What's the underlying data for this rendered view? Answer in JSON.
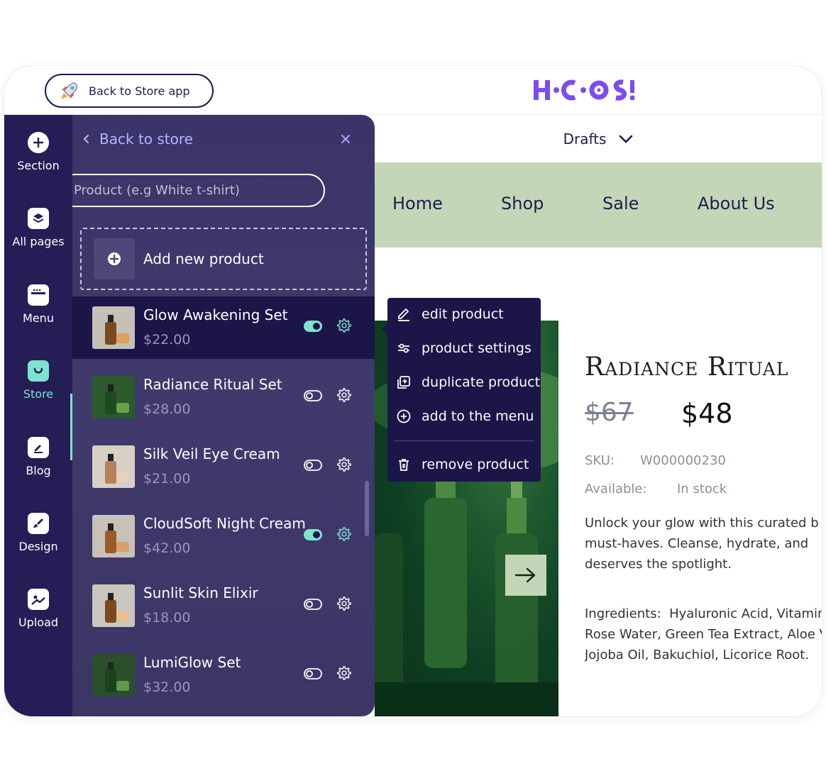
{
  "topbar": {
    "back_label": "Back to Store app",
    "logo_text": "HOCOOS"
  },
  "preview": {
    "drafts_label": "Drafts",
    "nav": [
      "Home",
      "Shop",
      "Sale",
      "About Us"
    ],
    "product": {
      "title": "Radiance Ritual",
      "old_price": "$67",
      "new_price": "$48",
      "sku_label": "SKU:",
      "sku_value": "W000000230",
      "available_label": "Available:",
      "available_value": "In stock",
      "description": "Unlock your glow with this curated b\nmust-haves. Cleanse, hydrate, and \ndeserves the spotlight.",
      "ingredients": "Ingredients:  Hyaluronic Acid, Vitamin\nRose Water, Green Tea Extract, Aloe V\nJojoba Oil, Bakuchiol, Licorice Root."
    }
  },
  "rail": [
    {
      "label": "Section",
      "icon": "plus-circle-icon"
    },
    {
      "label": "All pages",
      "icon": "layers-icon"
    },
    {
      "label": "Menu",
      "icon": "menu-window-icon"
    },
    {
      "label": "Store",
      "icon": "store-bag-icon",
      "active": true
    },
    {
      "label": "Blog",
      "icon": "edit-square-icon"
    },
    {
      "label": "Design",
      "icon": "brush-icon"
    },
    {
      "label": "Upload",
      "icon": "image-upload-icon"
    }
  ],
  "panel": {
    "back_label": "Back to store",
    "search_placeholder": "Product (e.g White t-shirt)",
    "add_label": "Add new product",
    "products": [
      {
        "name": "Glow Awakening Set",
        "price": "$22.00",
        "enabled": true,
        "selected": true
      },
      {
        "name": "Radiance Ritual Set",
        "price": "$28.00",
        "enabled": false
      },
      {
        "name": "Silk Veil Eye Cream",
        "price": "$21.00",
        "enabled": false
      },
      {
        "name": "CloudSoft Night Cream",
        "price": "$42.00",
        "enabled": true
      },
      {
        "name": "Sunlit Skin Elixir",
        "price": "$18.00",
        "enabled": false
      },
      {
        "name": "LumiGlow Set",
        "price": "$32.00",
        "enabled": false
      }
    ]
  },
  "context_menu": {
    "items": [
      "edit product",
      "product settings",
      "duplicate product",
      "add to the menu"
    ],
    "danger_item": "remove product"
  },
  "colors": {
    "rail_bg": "#241d56",
    "panel_bg": "#3d3769",
    "selected_bg": "#1b1548",
    "accent": "#7de3cf",
    "nav_band": "#c3d6b7",
    "logo": "#7b4cf0"
  }
}
